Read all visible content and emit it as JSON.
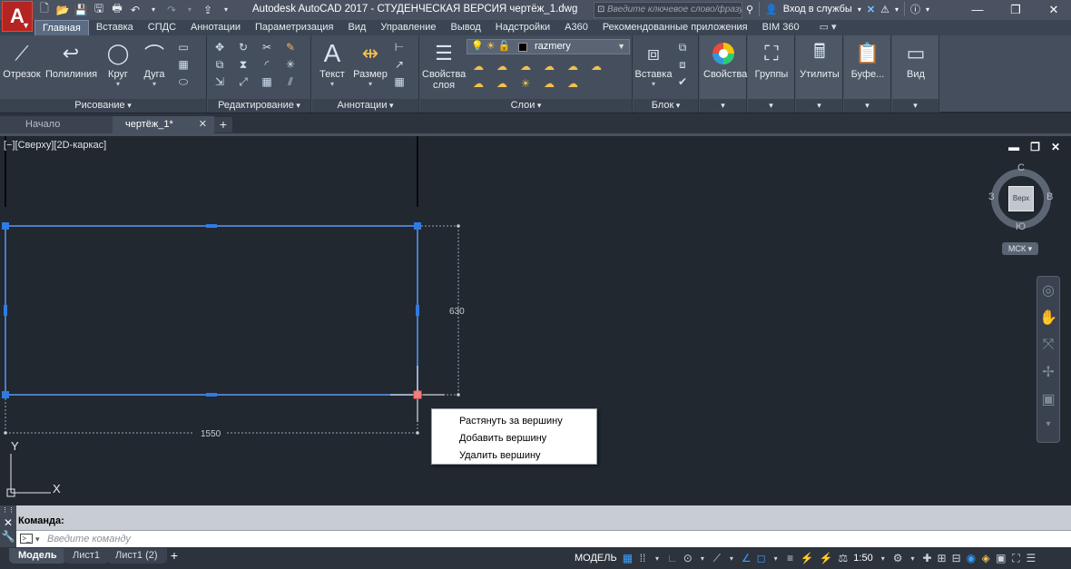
{
  "titlebar": {
    "app_menu_icon": "autocad-a-logo",
    "title": "Autodesk AutoCAD 2017 - СТУДЕНЧЕСКАЯ ВЕРСИЯ    чертёж_1.dwg",
    "search_placeholder": "Введите ключевое слово/фразу",
    "signin_label": "Вход в службы"
  },
  "ribbon_tabs": [
    "Главная",
    "Вставка",
    "СПДС",
    "Аннотации",
    "Параметризация",
    "Вид",
    "Управление",
    "Вывод",
    "Надстройки",
    "A360",
    "Рекомендованные приложения",
    "BIM 360"
  ],
  "ribbon": {
    "draw": {
      "title": "Рисование",
      "line": "Отрезок",
      "polyline": "Полилиния",
      "circle": "Круг",
      "arc": "Дуга"
    },
    "modify": {
      "title": "Редактирование"
    },
    "annotation": {
      "title": "Аннотации",
      "text": "Текст",
      "dimension": "Размер"
    },
    "layers": {
      "title": "Слои",
      "properties_line1": "Свойства",
      "properties_line2": "слоя",
      "current_layer": "razmery"
    },
    "block": {
      "title": "Блок",
      "insert": "Вставка"
    },
    "properties": {
      "label": "Свойства"
    },
    "groups": {
      "label": "Группы"
    },
    "utilities": {
      "label": "Утилиты"
    },
    "clipboard": {
      "label": "Буфе..."
    },
    "view": {
      "label": "Вид"
    }
  },
  "doc_tabs": {
    "start": "Начало",
    "drawing": "чертёж_1*"
  },
  "viewport": {
    "label": "[−][Сверху][2D-каркас]",
    "viewcube": {
      "face": "Верх",
      "north": "С",
      "south": "Ю",
      "west": "З",
      "east": "В"
    },
    "ucs": "МСК",
    "dim_vertical": "630",
    "dim_horizontal": "1550",
    "axis_x": "X",
    "axis_y": "Y"
  },
  "context_menu": {
    "items": [
      "Растянуть за вершину",
      "Добавить вершину",
      "Удалить вершину"
    ]
  },
  "command": {
    "history_label": "Команда:",
    "input_placeholder": "Введите команду"
  },
  "layout_tabs": [
    "Модель",
    "Лист1",
    "Лист1 (2)"
  ],
  "status": {
    "model": "МОДЕЛЬ",
    "scale": "1:50"
  }
}
